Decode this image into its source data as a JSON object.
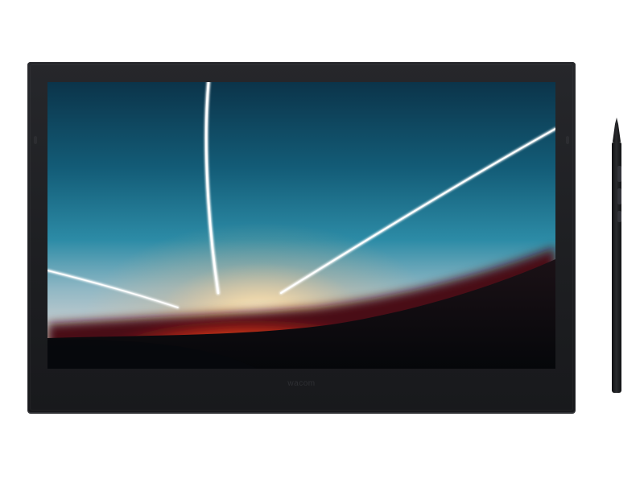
{
  "device": {
    "brand_label": "wacom",
    "body_color": "#1f2023",
    "pen_color": "#1a1b1d"
  },
  "screen_wallpaper": {
    "colors": {
      "sky_top": "#0d3b52",
      "sky_mid": "#1d7a97",
      "haze": "#b9c8cf",
      "sun_core": "#fff2cf",
      "sun_orange": "#f07a1e",
      "sun_red": "#c0241a",
      "ground": "#080a0e",
      "beam": "#ffffff"
    }
  },
  "icons": [
    "pen-side-button-icon",
    "pen-tip-icon"
  ]
}
